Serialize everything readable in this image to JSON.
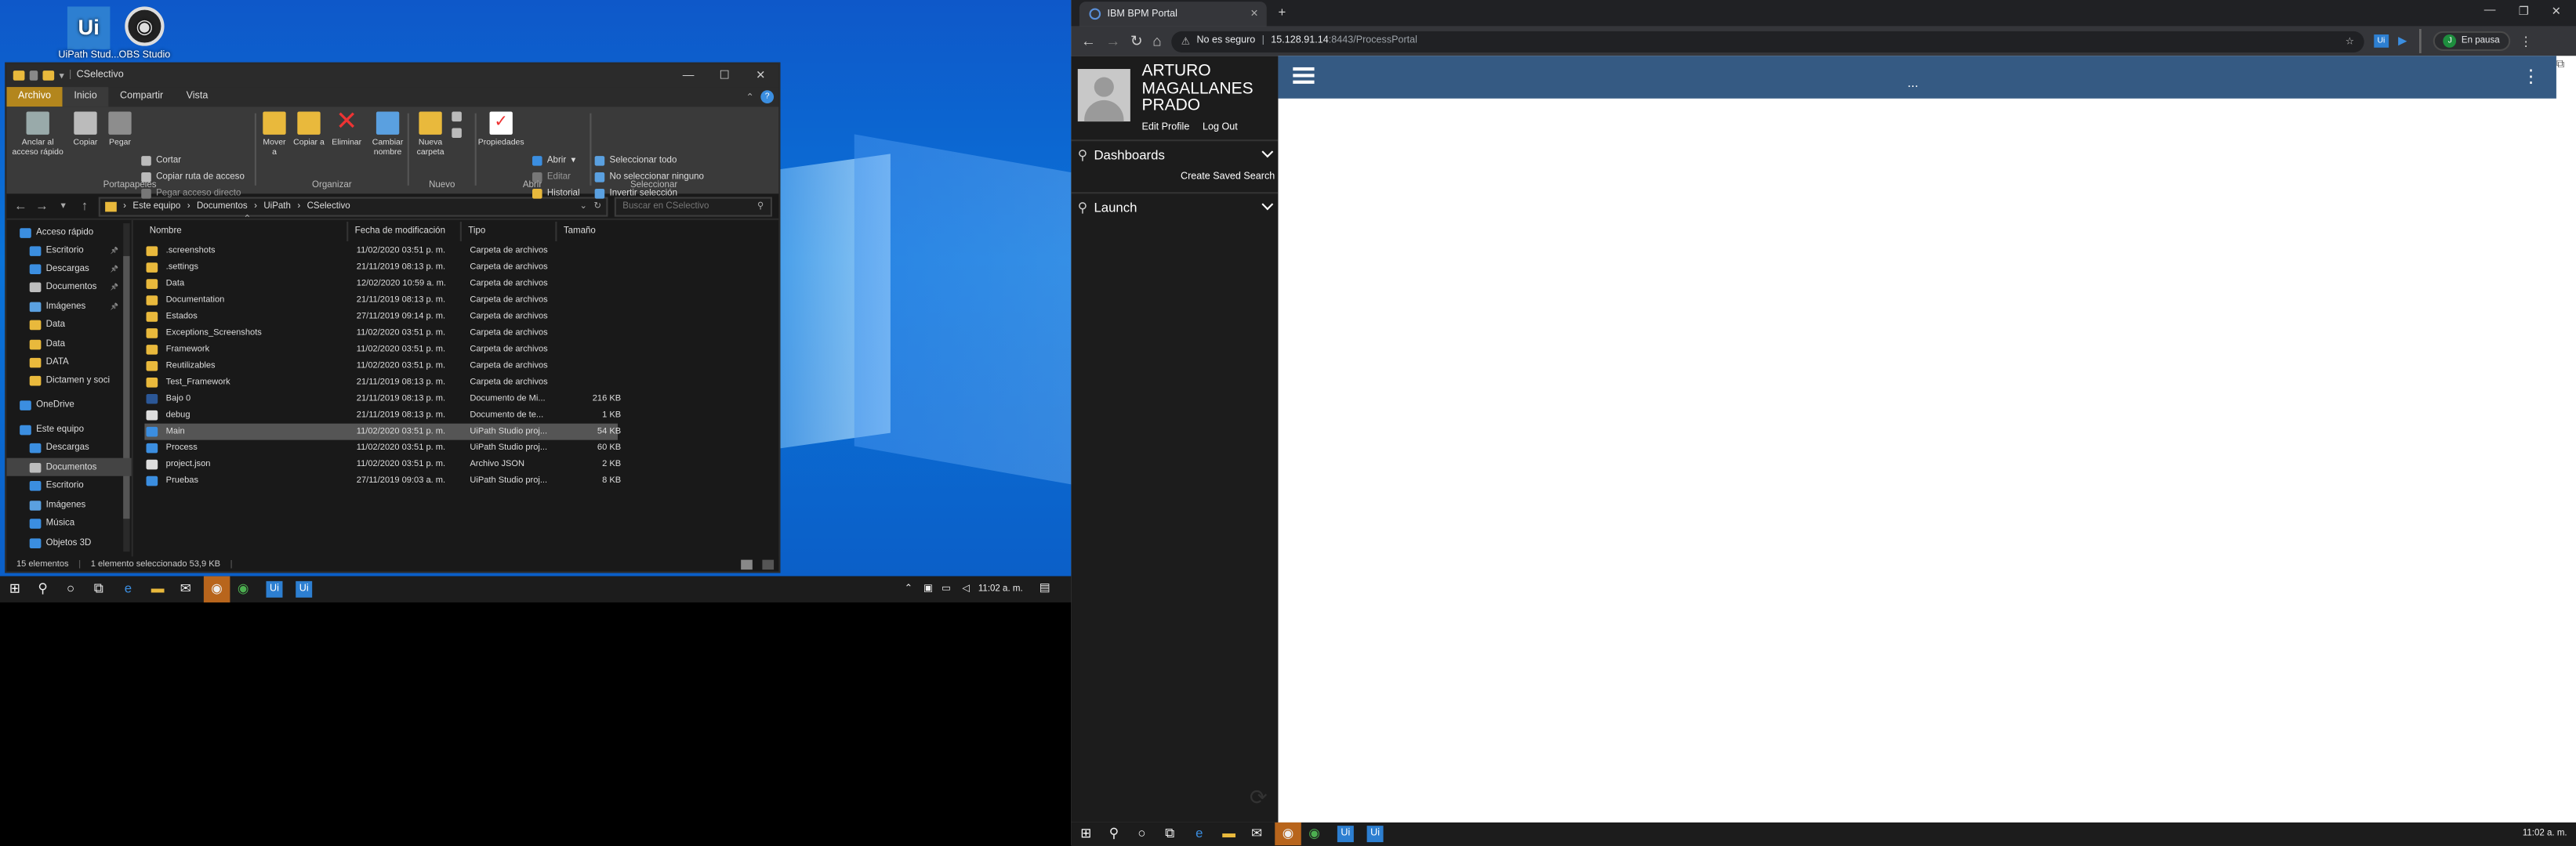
{
  "desktop": {
    "icons": [
      {
        "label": "UiPath Stud...",
        "icon": "uipath-icon"
      },
      {
        "label": "OBS Studio",
        "icon": "obs-icon"
      }
    ]
  },
  "explorer": {
    "title": "CSelectivo",
    "ribbon_tabs": [
      "Archivo",
      "Inicio",
      "Compartir",
      "Vista"
    ],
    "clipboard": {
      "pin": "Anclar al acceso rápido",
      "copy": "Copiar",
      "paste": "Pegar",
      "cut": "Cortar",
      "copy_path": "Copiar ruta de acceso",
      "paste_shortcut": "Pegar acceso directo",
      "label": "Portapapeles"
    },
    "organize": {
      "move": "Mover a",
      "copy_to": "Copiar a",
      "delete": "Eliminar",
      "rename": "Cambiar nombre",
      "label": "Organizar"
    },
    "new": {
      "folder": "Nueva carpeta",
      "label": "Nuevo"
    },
    "open": {
      "properties": "Propiedades",
      "open": "Abrir",
      "edit": "Editar",
      "history": "Historial",
      "label": "Abrir"
    },
    "select": {
      "all": "Seleccionar todo",
      "none": "No seleccionar ninguno",
      "invert": "Invertir selección",
      "label": "Seleccionar"
    },
    "path": [
      "Este equipo",
      "Documentos",
      "UiPath",
      "CSelectivo"
    ],
    "search_placeholder": "Buscar en CSelectivo",
    "nav_pane": [
      {
        "label": "Acceso rápido",
        "icon": "star-icon",
        "color": "#3b8ee0",
        "indent": 0
      },
      {
        "label": "Escritorio",
        "icon": "desktop-icon",
        "color": "#3b8ee0",
        "indent": 1,
        "pinned": true
      },
      {
        "label": "Descargas",
        "icon": "download-icon",
        "color": "#3b8ee0",
        "indent": 1,
        "pinned": true
      },
      {
        "label": "Documentos",
        "icon": "document-icon",
        "color": "#bdbdbd",
        "indent": 1,
        "pinned": true
      },
      {
        "label": "Imágenes",
        "icon": "image-icon",
        "color": "#5aa0e0",
        "indent": 1,
        "pinned": true
      },
      {
        "label": "Data",
        "icon": "folder-icon",
        "color": "#e9b93c",
        "indent": 1
      },
      {
        "label": "Data",
        "icon": "folder-icon",
        "color": "#e9b93c",
        "indent": 1
      },
      {
        "label": "DATA",
        "icon": "folder-icon",
        "color": "#e9b93c",
        "indent": 1
      },
      {
        "label": "Dictamen y soci",
        "icon": "folder-icon",
        "color": "#e9b93c",
        "indent": 1
      },
      {
        "label": "OneDrive",
        "icon": "cloud-icon",
        "color": "#3b8ee0",
        "indent": 0
      },
      {
        "label": "Este equipo",
        "icon": "computer-icon",
        "color": "#3b8ee0",
        "indent": 0
      },
      {
        "label": "Descargas",
        "icon": "download-icon",
        "color": "#3b8ee0",
        "indent": 1
      },
      {
        "label": "Documentos",
        "icon": "document-icon",
        "color": "#bdbdbd",
        "indent": 1,
        "selected": true
      },
      {
        "label": "Escritorio",
        "icon": "desktop-icon",
        "color": "#3b8ee0",
        "indent": 1
      },
      {
        "label": "Imágenes",
        "icon": "image-icon",
        "color": "#5aa0e0",
        "indent": 1
      },
      {
        "label": "Música",
        "icon": "music-icon",
        "color": "#3b8ee0",
        "indent": 1
      },
      {
        "label": "Objetos 3D",
        "icon": "cube-icon",
        "color": "#3b8ee0",
        "indent": 1
      }
    ],
    "columns": [
      "Nombre",
      "Fecha de modificación",
      "Tipo",
      "Tamaño"
    ],
    "files": [
      {
        "name": ".screenshots",
        "date": "11/02/2020 03:51 p. m.",
        "type": "Carpeta de archivos",
        "size": "",
        "icon": "folder-icon",
        "color": "#e9b93c"
      },
      {
        "name": ".settings",
        "date": "21/11/2019 08:13 p. m.",
        "type": "Carpeta de archivos",
        "size": "",
        "icon": "folder-icon",
        "color": "#e9b93c"
      },
      {
        "name": "Data",
        "date": "12/02/2020 10:59 a. m.",
        "type": "Carpeta de archivos",
        "size": "",
        "icon": "folder-icon",
        "color": "#e9b93c"
      },
      {
        "name": "Documentation",
        "date": "21/11/2019 08:13 p. m.",
        "type": "Carpeta de archivos",
        "size": "",
        "icon": "folder-icon",
        "color": "#e9b93c"
      },
      {
        "name": "Estados",
        "date": "27/11/2019 09:14 p. m.",
        "type": "Carpeta de archivos",
        "size": "",
        "icon": "folder-icon",
        "color": "#e9b93c"
      },
      {
        "name": "Exceptions_Screenshots",
        "date": "11/02/2020 03:51 p. m.",
        "type": "Carpeta de archivos",
        "size": "",
        "icon": "folder-icon",
        "color": "#e9b93c"
      },
      {
        "name": "Framework",
        "date": "11/02/2020 03:51 p. m.",
        "type": "Carpeta de archivos",
        "size": "",
        "icon": "folder-icon",
        "color": "#e9b93c"
      },
      {
        "name": "Reutilizables",
        "date": "11/02/2020 03:51 p. m.",
        "type": "Carpeta de archivos",
        "size": "",
        "icon": "folder-icon",
        "color": "#e9b93c"
      },
      {
        "name": "Test_Framework",
        "date": "21/11/2019 08:13 p. m.",
        "type": "Carpeta de archivos",
        "size": "",
        "icon": "folder-icon",
        "color": "#e9b93c"
      },
      {
        "name": "Bajo 0",
        "date": "21/11/2019 08:13 p. m.",
        "type": "Documento de Mi...",
        "size": "216 KB",
        "icon": "word-doc-icon",
        "color": "#2b5797"
      },
      {
        "name": "debug",
        "date": "21/11/2019 08:13 p. m.",
        "type": "Documento de te...",
        "size": "1 KB",
        "icon": "text-file-icon",
        "color": "#dddddd"
      },
      {
        "name": "Main",
        "date": "11/02/2020 03:51 p. m.",
        "type": "UiPath Studio proj...",
        "size": "54 KB",
        "icon": "uipath-file-icon",
        "color": "#3b8ee0",
        "selected": true
      },
      {
        "name": "Process",
        "date": "11/02/2020 03:51 p. m.",
        "type": "UiPath Studio proj...",
        "size": "60 KB",
        "icon": "uipath-file-icon",
        "color": "#3b8ee0"
      },
      {
        "name": "project.json",
        "date": "11/02/2020 03:51 p. m.",
        "type": "Archivo JSON",
        "size": "2 KB",
        "icon": "json-file-icon",
        "color": "#dddddd"
      },
      {
        "name": "Pruebas",
        "date": "27/11/2019 09:03 a. m.",
        "type": "UiPath Studio proj...",
        "size": "8 KB",
        "icon": "uipath-file-icon",
        "color": "#3b8ee0"
      }
    ],
    "status": {
      "count": "15 elementos",
      "selection": "1 elemento seleccionado  53,9 KB"
    }
  },
  "left_taskbar": {
    "time": "11:02 a. m."
  },
  "browser": {
    "tab_title": "IBM BPM Portal",
    "not_secure": "No es seguro",
    "url_host": "15.128.91.14",
    "url_rest": ":8443/ProcessPortal",
    "paused": "En pausa",
    "profile_initial": "J"
  },
  "bpm": {
    "user_name_1": "ARTURO",
    "user_name_2": "MAGALLANES",
    "user_name_3": "PRADO",
    "edit_profile": "Edit Profile",
    "log_out": "Log Out",
    "dashboards": "Dashboards",
    "create_saved_search": "Create Saved Search",
    "launch": "Launch",
    "more": "...",
    "header_color": "#355a83"
  },
  "right_taskbar": {
    "time": "11:02 a. m."
  }
}
